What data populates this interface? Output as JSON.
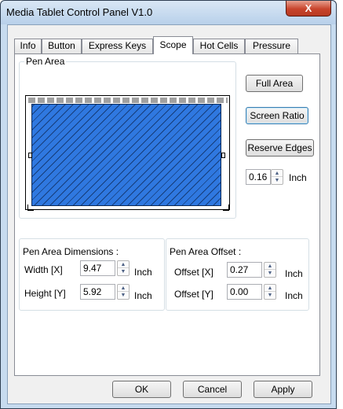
{
  "window": {
    "title": "Media Tablet Control Panel V1.0",
    "close_label": "X"
  },
  "tabs": [
    {
      "label": "Info",
      "active": false
    },
    {
      "label": "Button",
      "active": false
    },
    {
      "label": "Express Keys",
      "active": false
    },
    {
      "label": "Scope",
      "active": true
    },
    {
      "label": "Hot Cells",
      "active": false
    },
    {
      "label": "Pressure",
      "active": false
    }
  ],
  "pen_area": {
    "group_label": "Pen Area",
    "full_area_label": "Full Area",
    "screen_ratio_label": "Screen Ratio",
    "reserve_edges_label": "Reserve Edges",
    "reserve_value": "0.16",
    "reserve_unit": "Inch"
  },
  "dimensions": {
    "group_label": "Pen Area Dimensions :",
    "width_label": "Width [X]",
    "width_value": "9.47",
    "width_unit": "Inch",
    "height_label": "Height [Y]",
    "height_value": "5.92",
    "height_unit": "Inch"
  },
  "offset": {
    "group_label": "Pen Area Offset :",
    "x_label": "Offset [X]",
    "x_value": "0.27",
    "x_unit": "Inch",
    "y_label": "Offset [Y]",
    "y_value": "0.00",
    "y_unit": "Inch"
  },
  "footer": {
    "ok_label": "OK",
    "cancel_label": "Cancel",
    "apply_label": "Apply"
  },
  "colors": {
    "pen_area_fill": "#2f78e0",
    "close_button": "#c8442c"
  }
}
